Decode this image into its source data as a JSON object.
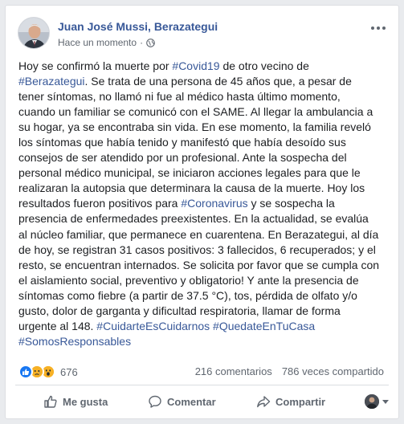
{
  "post": {
    "author": "Juan José Mussi, Berazategui",
    "time": "Hace un momento",
    "separator": "·",
    "privacy_icon": "globe-icon",
    "options_icon": "more-options-icon",
    "text_lines": [
      [
        {
          "t": "Hoy se confirmó la muerte por "
        },
        {
          "t": "#Covid19",
          "tag": true
        },
        {
          "t": " de otro vecino de"
        }
      ],
      [
        {
          "t": "#Berazategui",
          "tag": true
        },
        {
          "t": ". Se trata de una persona de 45 años que, a pesar de"
        }
      ],
      [
        {
          "t": "tener síntomas, no llamó ni fue al médico hasta último momento,"
        }
      ],
      [
        {
          "t": "cuando un familiar se comunicó con el SAME. Al llegar la ambulancia a"
        }
      ],
      [
        {
          "t": "su hogar, ya se encontraba sin vida. En ese momento, la familia reveló"
        }
      ],
      [
        {
          "t": "los síntomas que había tenido y manifestó que había desoído sus"
        }
      ],
      [
        {
          "t": "consejos de ser atendido por un profesional. Ante la sospecha del"
        }
      ],
      [
        {
          "t": "personal médico municipal, se iniciaron acciones legales para que le"
        }
      ],
      [
        {
          "t": "realizaran la autopsia que determinara la causa de la muerte. Hoy los"
        }
      ],
      [
        {
          "t": "resultados fueron positivos para "
        },
        {
          "t": "#Coronavirus",
          "tag": true
        },
        {
          "t": " y se sospecha la"
        }
      ],
      [
        {
          "t": "presencia de enfermedades preexistentes. En la actualidad, se evalúa"
        }
      ],
      [
        {
          "t": "al núcleo familiar, que permanece en cuarentena. En Berazategui, al día"
        }
      ],
      [
        {
          "t": "de hoy, se registran 31 casos positivos: 3 fallecidos, 6 recuperados; y el"
        }
      ],
      [
        {
          "t": "resto, se encuentran internados. Se solicita por favor que se cumpla con"
        }
      ],
      [
        {
          "t": "el aislamiento social, preventivo y obligatorio! Y ante la presencia de"
        }
      ],
      [
        {
          "t": "síntomas como fiebre (a partir de 37.5 °C), tos, pérdida de olfato y/o"
        }
      ],
      [
        {
          "t": "gusto, dolor de garganta y dificultad respiratoria, llamar de forma"
        }
      ],
      [
        {
          "t": "urgente al 148. "
        },
        {
          "t": "#CuidarteEsCuidarnos",
          "tag": true
        },
        {
          "t": " "
        },
        {
          "t": "#QuedateEnTuCasa",
          "tag": true
        }
      ],
      [
        {
          "t": "#SomosResponsables",
          "tag": true
        }
      ]
    ]
  },
  "stats": {
    "reaction_icons": [
      "like-reaction-icon",
      "sad-reaction-icon",
      "wow-reaction-icon"
    ],
    "reaction_count": "676",
    "comments": "216 comentarios",
    "shares": "786 veces compartido"
  },
  "actions": {
    "like": "Me gusta",
    "comment": "Comentar",
    "share": "Compartir"
  },
  "colors": {
    "link": "#385898",
    "text": "#1c1e21",
    "secondary": "#606770",
    "like_blue": "#1877f2",
    "reaction_yellow": "#f7b125"
  }
}
